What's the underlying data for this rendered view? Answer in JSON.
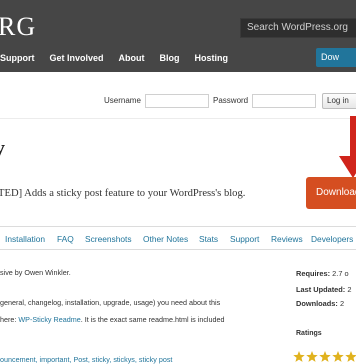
{
  "header": {
    "logo": "RG",
    "search_placeholder": "Search WordPress.org",
    "nav": [
      "Support",
      "Get Involved",
      "About",
      "Blog",
      "Hosting"
    ],
    "download_label": "Dow"
  },
  "login": {
    "username_label": "Username",
    "password_label": "Password",
    "button_label": "Log in"
  },
  "plugin": {
    "title": "y",
    "description": "TED] Adds a sticky post feature to your WordPress's blog.",
    "download_button": "Download"
  },
  "tabs": [
    "Installation",
    "FAQ",
    "Screenshots",
    "Other Notes",
    "Stats",
    "Support",
    "Reviews",
    "Developers"
  ],
  "content": {
    "author_line": "sive by Owen Winkler.",
    "para_line1": "general, changelog, installation, upgrade, usage) you need about this",
    "para_line2_prefix": "here: ",
    "para_line2_link": "WP-Sticky Readme",
    "para_line2_suffix": ". It is the exact same readme.html is included",
    "tags_line": "ouncement, important, Post, sticky, stickys, sticky post"
  },
  "sidebar": {
    "requires_label": "Requires:",
    "requires_value": "2.7 o",
    "last_updated_label": "Last Updated:",
    "last_updated_value": "2",
    "downloads_label": "Downloads:",
    "downloads_value": "2",
    "ratings_label": "Ratings"
  },
  "rating": {
    "stars_shown": 5
  },
  "colors": {
    "topbar": "#464646",
    "accent_blue": "#21759b",
    "download_orange": "#d54e21",
    "arrow_red": "#d0241b",
    "star_gold": "#e0b21e"
  }
}
